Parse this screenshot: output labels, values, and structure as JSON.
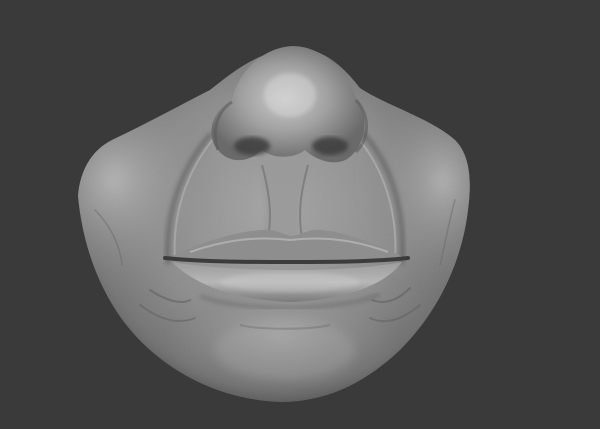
{
  "scene": {
    "subject": "sculpted-lower-face",
    "background_color": "#3a3a3a",
    "material_color": "#8a8a8a",
    "shadow_color": "#3e3e3e",
    "highlight_color": "#d2d2d2"
  }
}
